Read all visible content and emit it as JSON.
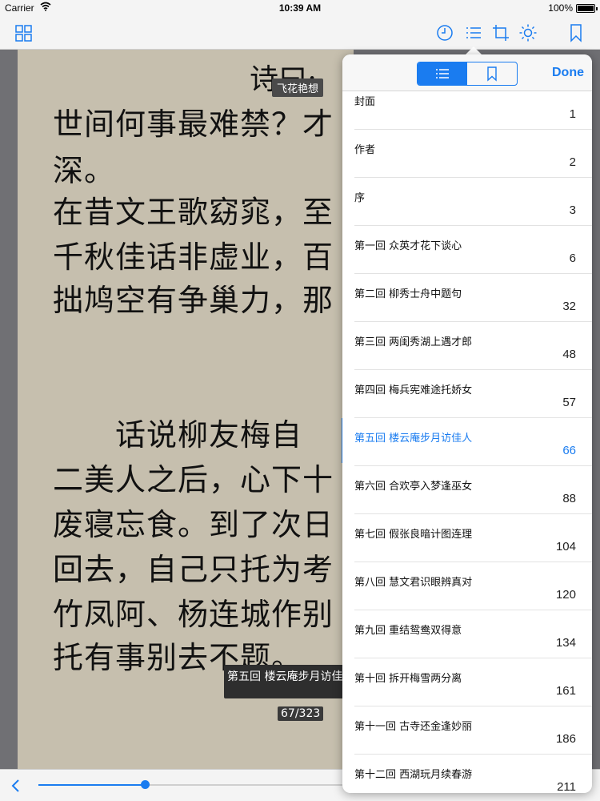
{
  "status_bar": {
    "carrier": "Carrier",
    "time": "10:39 AM",
    "battery_percent": "100%"
  },
  "toolbar": {
    "icons": [
      "grid-icon",
      "clock-icon",
      "list-icon",
      "crop-icon",
      "brightness-icon",
      "bookmark-icon"
    ]
  },
  "page": {
    "poem_title": "诗曰:",
    "header_label": "飞花艳想",
    "lines": [
      "世间何事最难禁？才",
      "深。",
      "在昔文王歌窈窕，至",
      "千秋佳话非虚业，百",
      "拙鸠空有争巢力，那",
      "",
      "　　话说柳友梅自",
      "二美人之后，心下十",
      "废寝忘食。到了次日",
      "回去，自己只托为考",
      "竹凤阿、杨连城作别",
      "托有事别去不题。"
    ],
    "chapter_label": "第五回 楼云庵步月访佳人",
    "page_counter": "67/323"
  },
  "slider": {
    "progress": 0.35
  },
  "popover": {
    "done_label": "Done",
    "active_segment": "toc",
    "toc": [
      {
        "title": "封面",
        "page": "1"
      },
      {
        "title": "作者",
        "page": "2"
      },
      {
        "title": "序",
        "page": "3"
      },
      {
        "title": "第一回 众英才花下谈心",
        "page": "6"
      },
      {
        "title": "第二回 柳秀士舟中题句",
        "page": "32"
      },
      {
        "title": "第三回 两闺秀湖上遇才郎",
        "page": "48"
      },
      {
        "title": "第四回 梅兵宪难途托娇女",
        "page": "57"
      },
      {
        "title": "第五回 楼云庵步月访佳人",
        "page": "66",
        "current": true
      },
      {
        "title": "第六回 合欢亭入梦逢巫女",
        "page": "88"
      },
      {
        "title": "第七回 假张良暗计图连理",
        "page": "104"
      },
      {
        "title": "第八回 慧文君识眼辨真对",
        "page": "120"
      },
      {
        "title": "第九回 重结鸳鸯双得意",
        "page": "134"
      },
      {
        "title": "第十回 拆开梅雪两分离",
        "page": "161"
      },
      {
        "title": "第十一回 古寺还金逢妙丽",
        "page": "186"
      },
      {
        "title": "第十二回 西湖玩月续春游",
        "page": "211"
      }
    ]
  },
  "colors": {
    "accent": "#1a7cf0",
    "page_background": "#c6bfae"
  }
}
